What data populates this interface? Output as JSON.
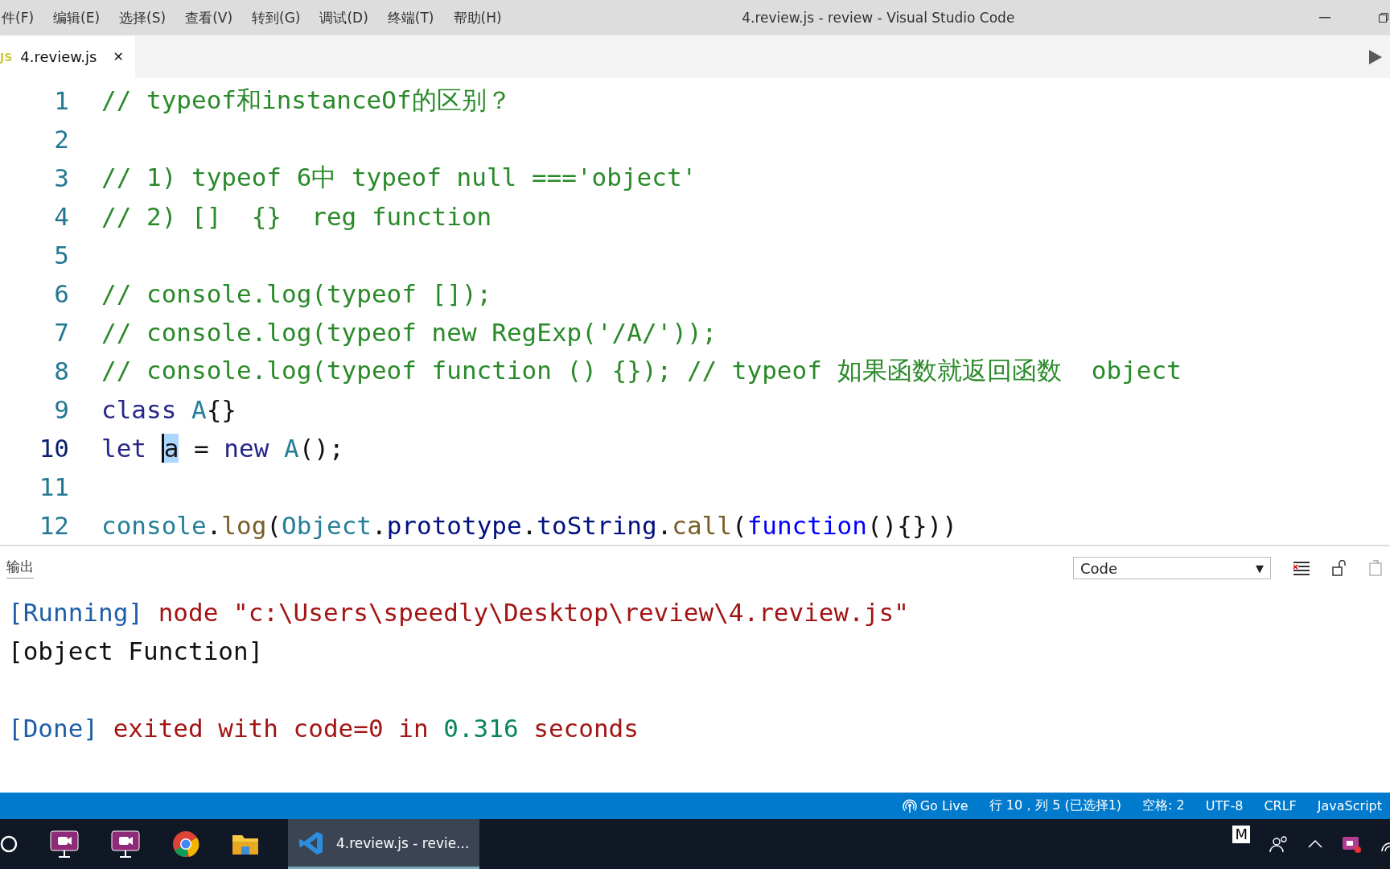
{
  "menu": [
    "件(F)",
    "编辑(E)",
    "选择(S)",
    "查看(V)",
    "转到(G)",
    "调试(D)",
    "终端(T)",
    "帮助(H)"
  ],
  "window": {
    "title": "4.review.js - review - Visual Studio Code"
  },
  "tabs": [
    {
      "icon": "JS",
      "label": "4.review.js",
      "close": "✕",
      "selected": true
    }
  ],
  "editor": {
    "lines": [
      {
        "number": "1",
        "current": false,
        "tokens": [
          {
            "kind": "comment",
            "text": "// typeof和instanceOf的区别？"
          }
        ]
      },
      {
        "number": "2",
        "current": false
      },
      {
        "number": "3",
        "current": false,
        "tokens": [
          {
            "kind": "comment",
            "text": "// 1) typeof 6中 typeof null ==='object'"
          }
        ]
      },
      {
        "number": "4",
        "current": false,
        "tokens": [
          {
            "kind": "comment",
            "text": "// 2) []  {}  reg function"
          }
        ]
      },
      {
        "number": "5",
        "current": false
      },
      {
        "number": "6",
        "current": false,
        "tokens": [
          {
            "kind": "comment",
            "text": "// console.log(typeof []);"
          }
        ]
      },
      {
        "number": "7",
        "current": false,
        "tokens": [
          {
            "kind": "comment",
            "text": "// console.log(typeof new RegExp('/A/'));"
          }
        ]
      },
      {
        "number": "8",
        "current": false,
        "tokens": [
          {
            "kind": "comment",
            "text": "// console.log(typeof function () {}); // typeof 如果函数就返回函数  object"
          }
        ]
      },
      {
        "number": "9",
        "current": false,
        "tokens": [
          {
            "kind": "keyword",
            "text": "class "
          },
          {
            "kind": "type",
            "text": "A"
          },
          {
            "kind": "plain",
            "text": "{}"
          }
        ]
      },
      {
        "number": "10",
        "current": true,
        "tokens": [
          {
            "kind": "keyword",
            "text": "let "
          },
          {
            "kind": "selected",
            "text": "a"
          },
          {
            "kind": "plain",
            "text": " = "
          },
          {
            "kind": "keyword",
            "text": "new "
          },
          {
            "kind": "type",
            "text": "A"
          },
          {
            "kind": "plain",
            "text": "();"
          }
        ]
      },
      {
        "number": "11",
        "current": false
      },
      {
        "number": "12",
        "current": false,
        "tokens": [
          {
            "kind": "type",
            "text": "console"
          },
          {
            "kind": "plain",
            "text": "."
          },
          {
            "kind": "func",
            "text": "log"
          },
          {
            "kind": "plain",
            "text": "("
          },
          {
            "kind": "type",
            "text": "Object"
          },
          {
            "kind": "plain",
            "text": "."
          },
          {
            "kind": "var",
            "text": "prototype"
          },
          {
            "kind": "plain",
            "text": "."
          },
          {
            "kind": "var",
            "text": "toString"
          },
          {
            "kind": "plain",
            "text": "."
          },
          {
            "kind": "func",
            "text": "call"
          },
          {
            "kind": "plain",
            "text": "("
          },
          {
            "kind": "fnkw",
            "text": "function"
          },
          {
            "kind": "plain",
            "text": "(){}))"
          }
        ]
      }
    ]
  },
  "output": {
    "title": "输出",
    "channel": "Code",
    "dropdown_arrow": "▼",
    "lines": [
      {
        "tokens": [
          {
            "kind": "tag",
            "text": "[Running]"
          },
          {
            "kind": "string",
            "text": " node \"c:\\Users\\speedly\\Desktop\\review\\4.review.js\""
          }
        ]
      },
      {
        "tokens": [
          {
            "kind": "plain",
            "text": "[object Function]"
          }
        ]
      }
    ],
    "summary": {
      "tokens": [
        {
          "kind": "tag",
          "text": "[Done]"
        },
        {
          "kind": "string",
          "text": " exited with code=0 in "
        },
        {
          "kind": "number",
          "text": "0.316"
        },
        {
          "kind": "string",
          "text": " seconds"
        }
      ]
    }
  },
  "status_bar": {
    "go_live": "Go Live",
    "items": [
      "行 10，列 5 (已选择1)",
      "空格: 2",
      "UTF-8",
      "CRLF",
      "JavaScript"
    ]
  },
  "taskbar": {
    "active_window": "4.review.js - revie...",
    "tray_letter": "M"
  }
}
